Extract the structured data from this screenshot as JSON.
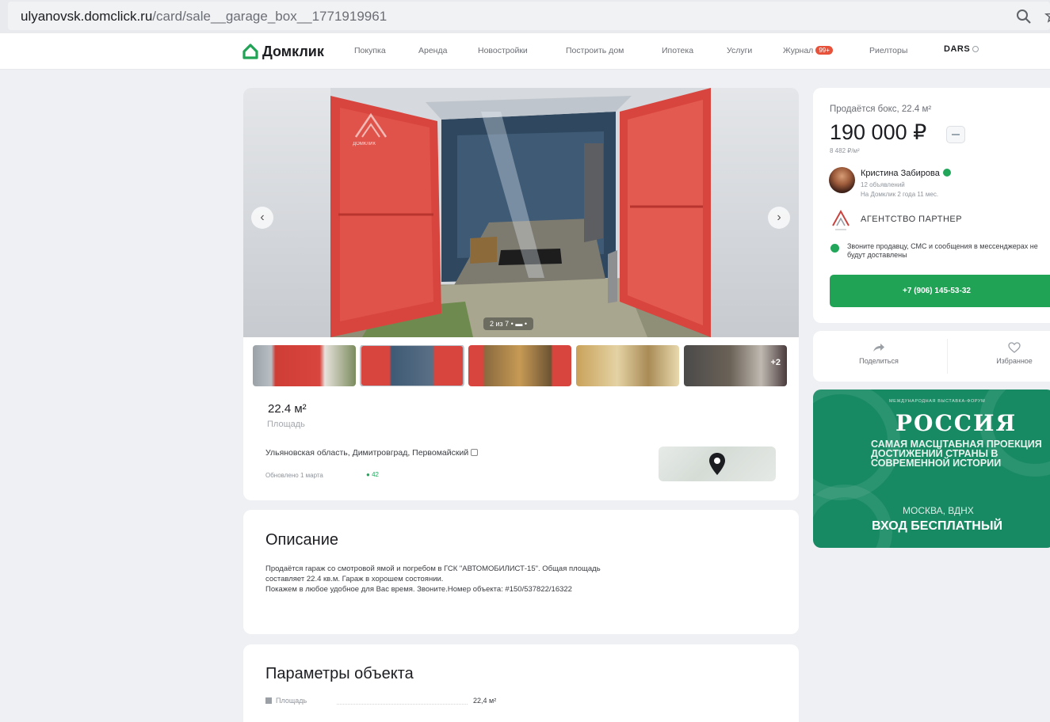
{
  "browser": {
    "url_host": "ulyanovsk.domclick.ru",
    "url_path": "/card/sale__garage_box__1771919961"
  },
  "header": {
    "logo": "Домклик",
    "nav": [
      "Покупка",
      "Аренда",
      "Новостройки",
      "Построить дом",
      "Ипотека",
      "Услуги",
      "Журнал",
      "Риелторы"
    ],
    "journal_badge": "99+",
    "brand": "DARS"
  },
  "gallery": {
    "counter": "2 из 7",
    "watermark": "ДОМКЛИК",
    "more_label": "+2"
  },
  "summary": {
    "area_value": "22.4 м²",
    "area_label": "Площадь",
    "address": "Ульяновская область, Димитровград, Первомайский",
    "updated": "Обновлено 1 марта",
    "views": "42"
  },
  "description": {
    "title": "Описание",
    "lines": [
      "Продаётся гараж со смотровой ямой и погребом в ГСК \"АВТОМОБИЛИСТ-15\". Общая площадь",
      "составляет 22.4 кв.м. Гараж в хорошем состоянии.",
      "Покажем в любое удобное для Вас время. Звоните.Номер объекта: #150/537822/16322"
    ]
  },
  "params": {
    "title": "Параметры объекта",
    "rows": [
      {
        "label": "Площадь",
        "value": "22,4 м²"
      }
    ]
  },
  "offer": {
    "heading": "Продаётся бокс, 22.4 м²",
    "price": "190 000 ₽",
    "price_per_m2": "8 482 ₽/м²",
    "seller_name": "Кристина Забирова",
    "seller_ads": "12 объявлений",
    "seller_since": "На Домклик 2 года 11 мес.",
    "agency": "АГЕНТСТВО ПАРТНЕР",
    "notice": "Звоните продавцу, СМС и сообщения в мессенджерах не будут доставлены",
    "phone": "+7 (906) 145-53-32"
  },
  "actions": {
    "share": "Поделиться",
    "favorite": "Избранное"
  },
  "ad": {
    "top": "МЕЖДУНАРОДНАЯ ВЫСТАВКА-ФОРУМ",
    "title": "РОССИЯ",
    "subtitle": "САМАЯ МАСШТАБНАЯ ПРОЕКЦИЯ ДОСТИЖЕНИЙ СТРАНЫ В СОВРЕМЕННОЙ ИСТОРИИ",
    "city": "МОСКВА, ВДНХ",
    "free": "ВХОД БЕСПЛАТНЫЙ"
  },
  "colors": {
    "accent_green": "#21a356",
    "ad_green": "#188a63",
    "gate_red": "#d8453e"
  }
}
